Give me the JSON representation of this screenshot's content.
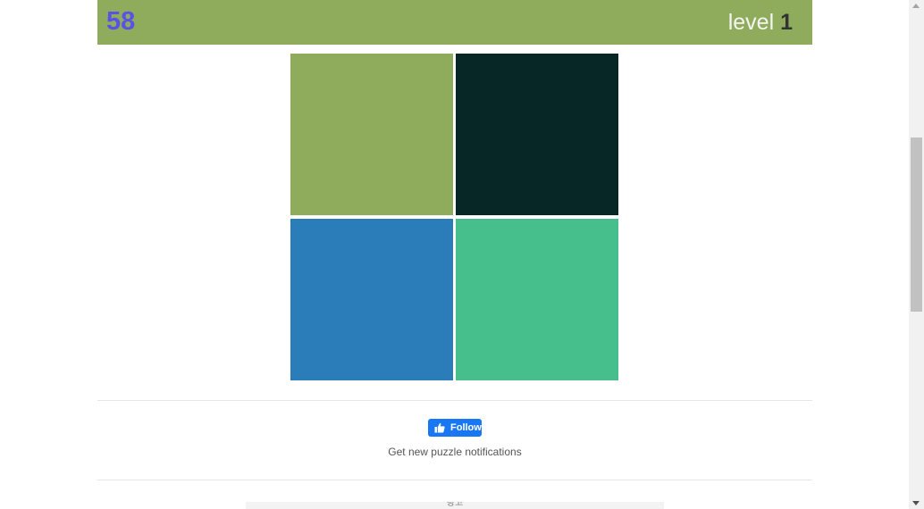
{
  "header": {
    "score": "58",
    "level_word": "level",
    "level_number": "1",
    "bar_color": "#8fac5c",
    "score_color": "#5a52e6"
  },
  "tiles": [
    {
      "color": "#8fac5c"
    },
    {
      "color": "#062726"
    },
    {
      "color": "#2a7db9"
    },
    {
      "color": "#47bf8c"
    }
  ],
  "social": {
    "follow_label": "Follow",
    "follow_icon": "thumbs-up-icon",
    "follow_color": "#1877f2",
    "notification_text": "Get new puzzle notifications"
  },
  "ad": {
    "label": "광고"
  }
}
